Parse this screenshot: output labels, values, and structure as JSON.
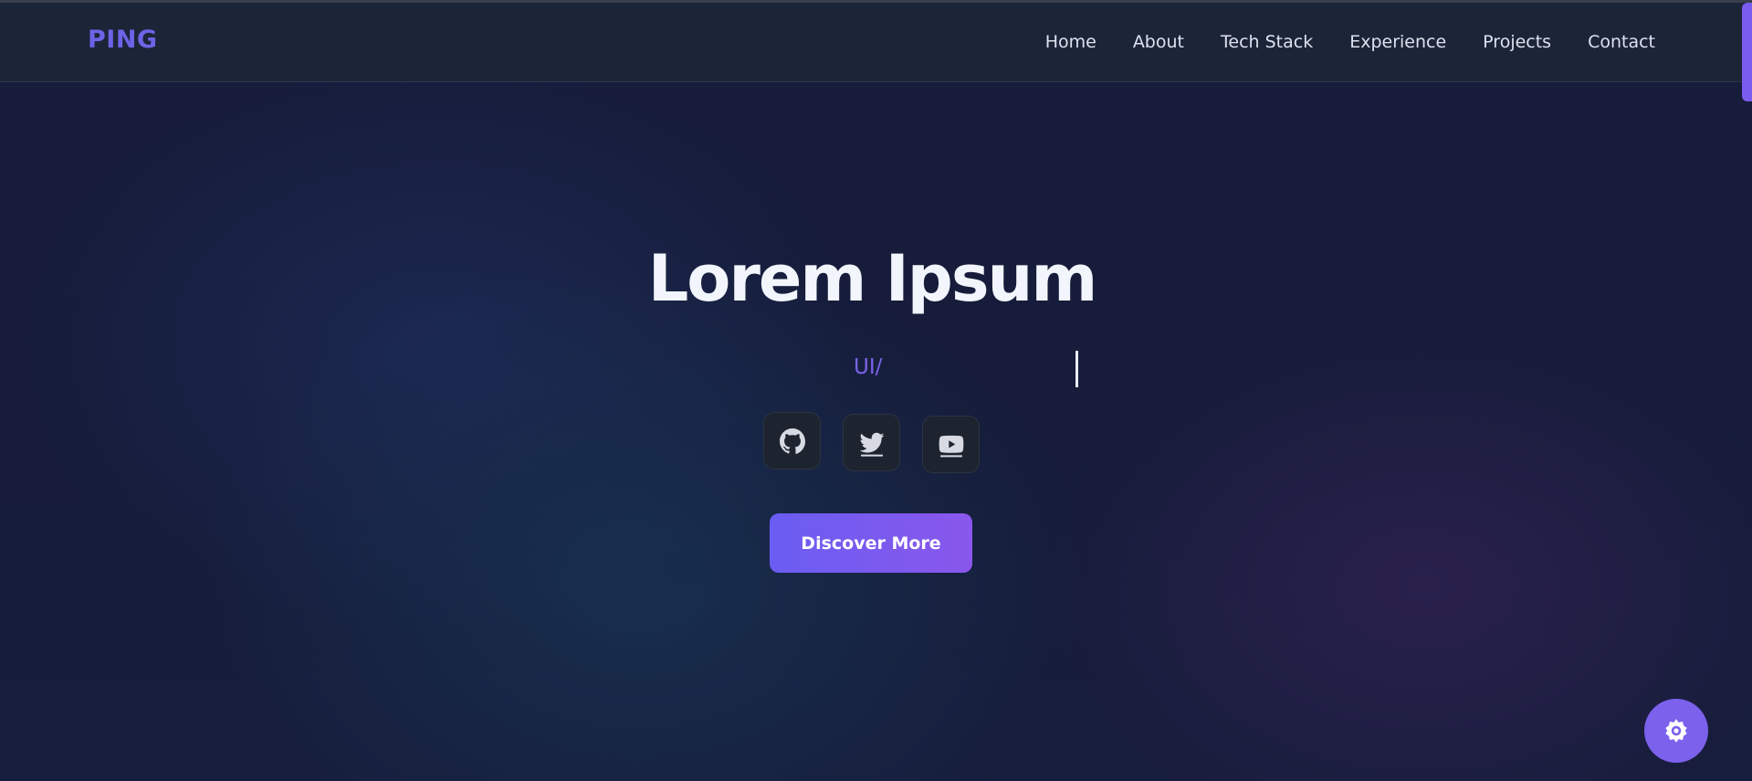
{
  "navbar": {
    "logo": "PING",
    "links": [
      "Home",
      "About",
      "Tech Stack",
      "Experience",
      "Projects",
      "Contact"
    ]
  },
  "hero": {
    "title": "Lorem Ipsum",
    "typed_text": "UI/",
    "socials": [
      {
        "name": "github",
        "icon": "github-icon"
      },
      {
        "name": "twitter",
        "icon": "twitter-icon"
      },
      {
        "name": "youtube",
        "icon": "youtube-icon"
      }
    ],
    "cta_label": "Discover More"
  },
  "fab": {
    "icon": "gear-icon"
  },
  "colors": {
    "accent": "#6d63e6",
    "button_start": "#6a5df2",
    "button_end": "#8a57ec",
    "background": "#161c3a",
    "navbar": "#1c2438"
  }
}
